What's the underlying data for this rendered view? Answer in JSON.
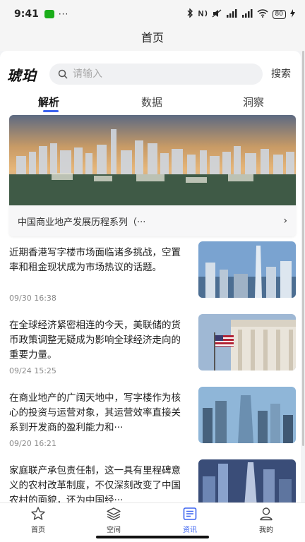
{
  "status_bar": {
    "time": "9:41",
    "dots": "···",
    "signal": "HD",
    "battery": "80"
  },
  "header": {
    "title": "首页"
  },
  "search": {
    "logo": "琥珀",
    "placeholder": "请输入",
    "button": "搜索"
  },
  "tabs": [
    {
      "label": "解析",
      "active": true
    },
    {
      "label": "数据",
      "active": false
    },
    {
      "label": "洞察",
      "active": false
    }
  ],
  "banner": {
    "caption": "中国商业地产发展历程系列（···",
    "icon": "chevron-right-icon"
  },
  "news": [
    {
      "title": "近期香港写字楼市场面临诸多挑战，空置率和租金现状成为市场热议的话题。",
      "time": "09/30 16:38"
    },
    {
      "title": "在全球经济紧密相连的今天，美联储的货币政策调整无疑成为影响全球经济走向的重要力量。",
      "time": "09/24 15:25"
    },
    {
      "title": "在商业地产的广阔天地中，写字楼作为核心的投资与运营对象，其运营效率直接关系到开发商的盈利能力和···",
      "time": "09/20 16:21"
    },
    {
      "title": "家庭联产承包责任制，这一具有里程碑意义的农村改革制度，不仅深刻改变了中国农村的面貌，还为中国经···",
      "time": ""
    }
  ],
  "bottom_tabs": [
    {
      "label": "首页",
      "icon": "star-icon",
      "active": false
    },
    {
      "label": "空间",
      "icon": "layers-icon",
      "active": false
    },
    {
      "label": "资讯",
      "icon": "news-icon",
      "active": true
    },
    {
      "label": "我的",
      "icon": "user-icon",
      "active": false
    }
  ],
  "colors": {
    "accent": "#3b63f0",
    "background": "#f2f3f5"
  }
}
